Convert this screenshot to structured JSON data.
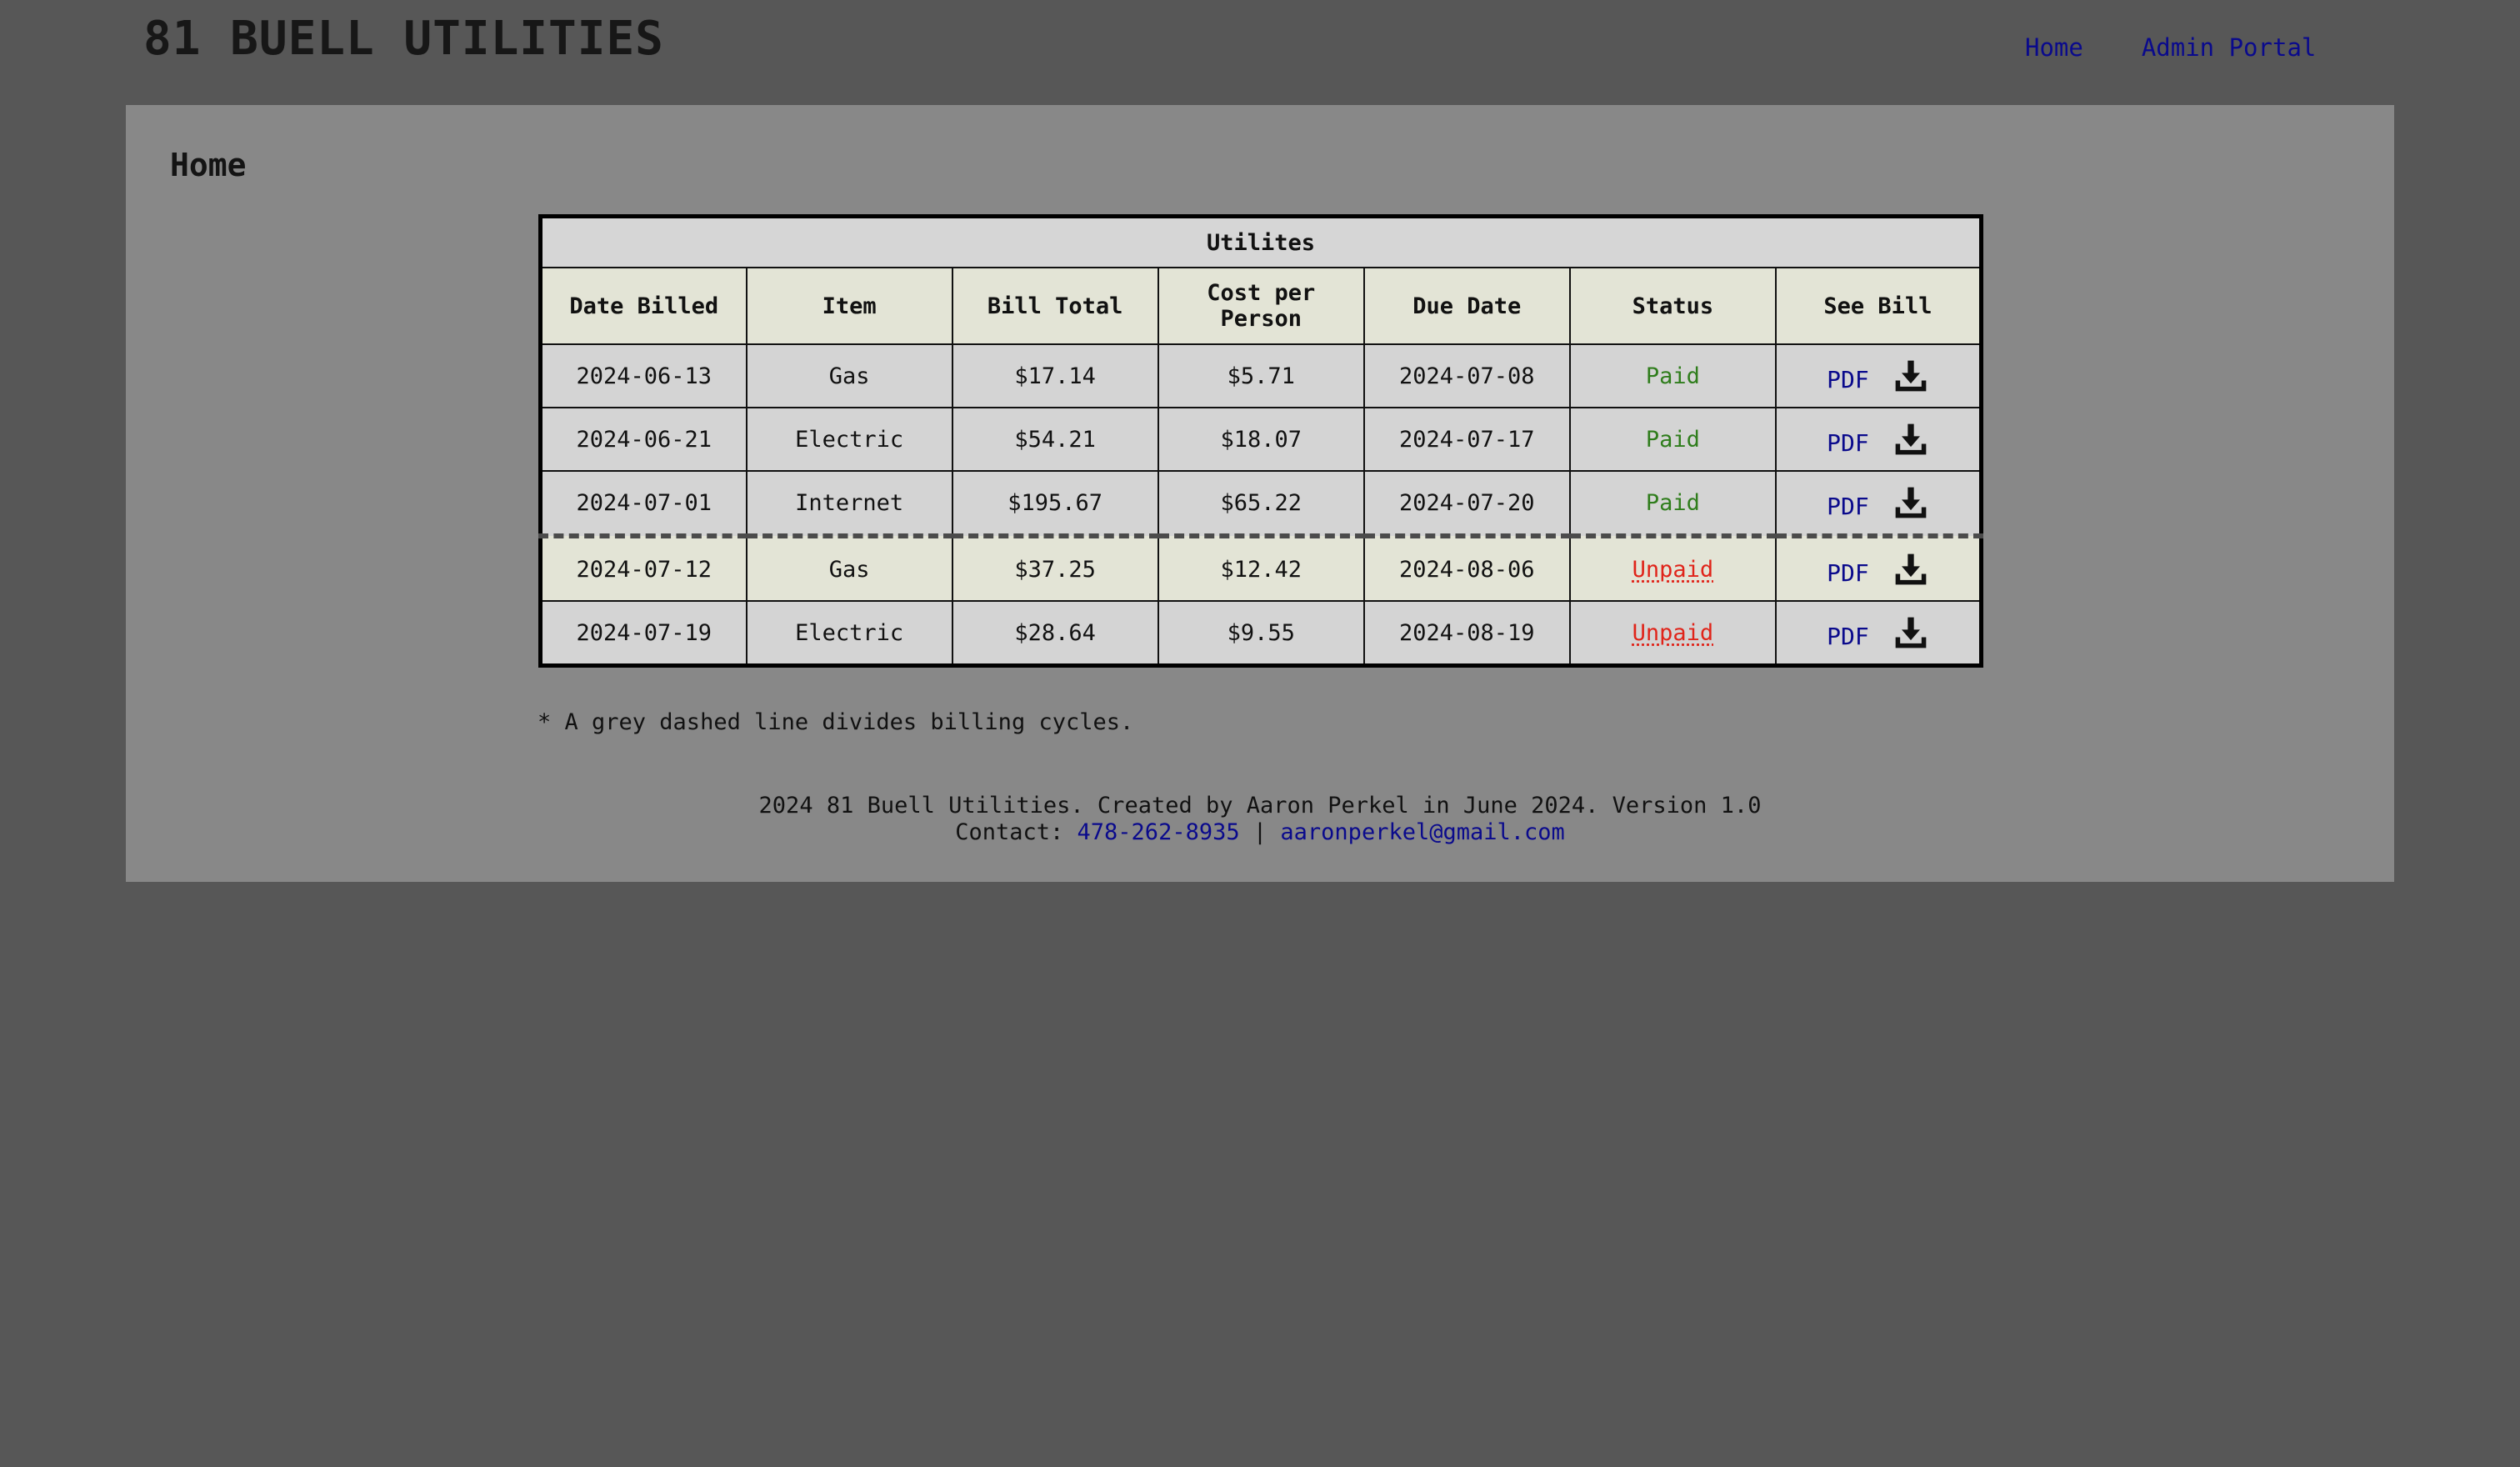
{
  "header": {
    "site_title": "81 BUELL UTILITIES",
    "nav": [
      {
        "label": "Home"
      },
      {
        "label": "Admin Portal"
      }
    ]
  },
  "main": {
    "heading": "Home",
    "table": {
      "caption": "Utilites",
      "columns": [
        "Date Billed",
        "Item",
        "Bill Total",
        "Cost per Person",
        "Due Date",
        "Status",
        "See Bill"
      ],
      "rows": [
        {
          "date_billed": "2024-06-13",
          "item": "Gas",
          "bill_total": "$17.14",
          "cost_per_person": "$5.71",
          "due_date": "2024-07-08",
          "status": "Paid",
          "link": "PDF"
        },
        {
          "date_billed": "2024-06-21",
          "item": "Electric",
          "bill_total": "$54.21",
          "cost_per_person": "$18.07",
          "due_date": "2024-07-17",
          "status": "Paid",
          "link": "PDF"
        },
        {
          "date_billed": "2024-07-01",
          "item": "Internet",
          "bill_total": "$195.67",
          "cost_per_person": "$65.22",
          "due_date": "2024-07-20",
          "status": "Paid",
          "link": "PDF"
        },
        {
          "date_billed": "2024-07-12",
          "item": "Gas",
          "bill_total": "$37.25",
          "cost_per_person": "$12.42",
          "due_date": "2024-08-06",
          "status": "Unpaid",
          "link": "PDF"
        },
        {
          "date_billed": "2024-07-19",
          "item": "Electric",
          "bill_total": "$28.64",
          "cost_per_person": "$9.55",
          "due_date": "2024-08-19",
          "status": "Unpaid",
          "link": "PDF"
        }
      ]
    },
    "footnote": "* A grey dashed line divides billing cycles."
  },
  "footer": {
    "line1": "2024 81 Buell Utilities. Created by Aaron Perkel in June 2024. Version 1.0",
    "contact_label": "Contact:",
    "phone": "478-262-8935",
    "separator": "|",
    "email": "aaronperkel@gmail.com"
  },
  "icons": {
    "download": "download-icon"
  },
  "colors": {
    "page_background": "#575757",
    "panel_background": "#888888",
    "link": "#0a0a8c",
    "paid": "#2f7d1c",
    "unpaid": "#e0241a",
    "table_header": "#e3e4d6",
    "table_row_alt": "#d4d4d4"
  }
}
